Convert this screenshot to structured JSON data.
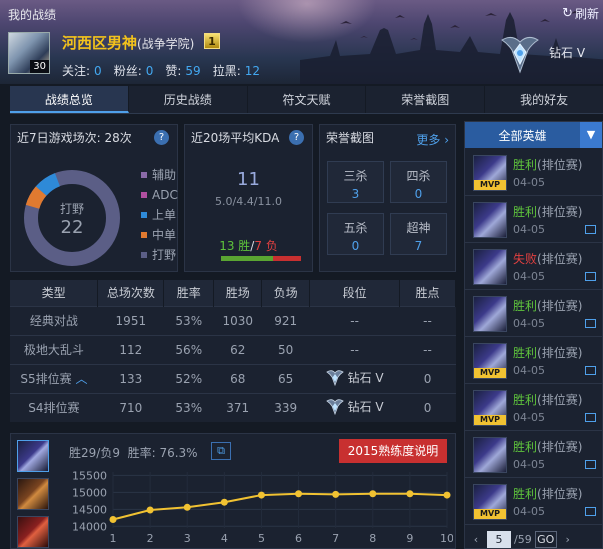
{
  "header": {
    "page_title": "我的战绩",
    "refresh_label": "刷新",
    "player_name": "河西区男神",
    "school": "(战争学院)",
    "level": "30",
    "rank_badge": "1",
    "socials": [
      {
        "label": "关注:",
        "value": "0"
      },
      {
        "label": "粉丝:",
        "value": "0"
      },
      {
        "label": "赞:",
        "value": "59"
      },
      {
        "label": "拉黑:",
        "value": "12"
      }
    ],
    "tier": "钻石 V"
  },
  "tabs": [
    "战绩总览",
    "历史战绩",
    "符文天赋",
    "荣誉截图",
    "我的好友"
  ],
  "recent_games": {
    "title": "近7日游戏场次: 28次",
    "help": "?",
    "center_label": "打野",
    "center_value": "22",
    "legend": [
      {
        "label": "辅助",
        "color": "#8a6aa8"
      },
      {
        "label": "ADC",
        "color": "#b04fa0"
      },
      {
        "label": "上单",
        "color": "#2e8ad8"
      },
      {
        "label": "中单",
        "color": "#e07a30"
      },
      {
        "label": "打野",
        "color": "#5b5e86"
      }
    ]
  },
  "kda": {
    "title": "近20场平均KDA",
    "help": "?",
    "value": "11",
    "detail": "5.0/4.4/11.0",
    "wins": "13 胜",
    "losses": "7 负",
    "win_fraction": 0.65
  },
  "honor": {
    "title": "荣誉截图",
    "more": "更多",
    "items": [
      {
        "label": "三杀",
        "value": "3"
      },
      {
        "label": "四杀",
        "value": "0"
      },
      {
        "label": "五杀",
        "value": "0"
      },
      {
        "label": "超神",
        "value": "7"
      }
    ]
  },
  "stats_table": {
    "headers": [
      "类型",
      "总场次数",
      "胜率",
      "胜场",
      "负场",
      "段位",
      "胜点"
    ],
    "rows": [
      {
        "type": "经典对战",
        "total": "1951",
        "rate": "53%",
        "wins": "1030",
        "losses": "921",
        "rank": "--",
        "points": "--"
      },
      {
        "type": "极地大乱斗",
        "total": "112",
        "rate": "56%",
        "wins": "62",
        "losses": "50",
        "rank": "--",
        "points": "--"
      },
      {
        "type": "S5排位赛",
        "total": "133",
        "rate": "52%",
        "wins": "68",
        "losses": "65",
        "rank": "钻石 V",
        "points": "0"
      },
      {
        "type": "S4排位赛",
        "total": "710",
        "rate": "53%",
        "wins": "371",
        "losses": "339",
        "rank": "钻石 V",
        "points": "0"
      }
    ]
  },
  "proficiency": {
    "record": "胜29/负9",
    "rate": "胜率: 76.3%",
    "badge": "2015熟练度说明"
  },
  "chart_data": {
    "type": "line",
    "x": [
      1,
      2,
      3,
      4,
      5,
      6,
      7,
      8,
      9,
      10
    ],
    "values": [
      14200,
      14480,
      14560,
      14710,
      14920,
      14960,
      14940,
      14960,
      14960,
      14920
    ],
    "yticks": [
      14000,
      14500,
      15000,
      15500
    ],
    "ylim": [
      13950,
      15600
    ],
    "line_color": "#f1c232",
    "grid": true
  },
  "hero_panel": {
    "selector": "全部英雄",
    "matches": [
      {
        "result": "胜利",
        "queue": "(排位赛)",
        "date": "04-05",
        "win": true,
        "mvp": true,
        "share": false
      },
      {
        "result": "胜利",
        "queue": "(排位赛)",
        "date": "04-05",
        "win": true,
        "mvp": false,
        "share": true
      },
      {
        "result": "失败",
        "queue": "(排位赛)",
        "date": "04-05",
        "win": false,
        "mvp": false,
        "share": true
      },
      {
        "result": "胜利",
        "queue": "(排位赛)",
        "date": "04-05",
        "win": true,
        "mvp": false,
        "share": true
      },
      {
        "result": "胜利",
        "queue": "(排位赛)",
        "date": "04-05",
        "win": true,
        "mvp": true,
        "share": true
      },
      {
        "result": "胜利",
        "queue": "(排位赛)",
        "date": "04-05",
        "win": true,
        "mvp": true,
        "share": true
      },
      {
        "result": "胜利",
        "queue": "(排位赛)",
        "date": "04-05",
        "win": true,
        "mvp": false,
        "share": true
      },
      {
        "result": "胜利",
        "queue": "(排位赛)",
        "date": "04-05",
        "win": true,
        "mvp": true,
        "share": true
      }
    ],
    "pager": {
      "current": "5",
      "total": "/59",
      "go": "GO"
    }
  }
}
